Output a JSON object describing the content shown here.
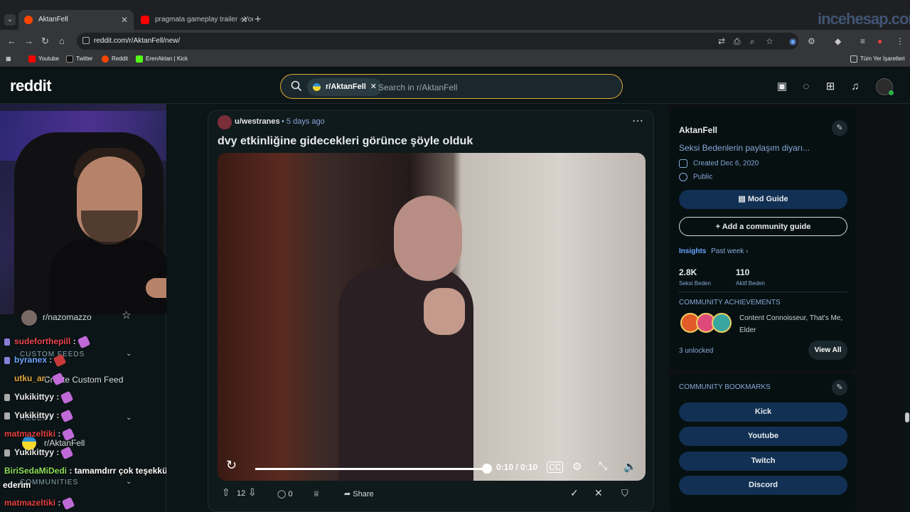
{
  "browser": {
    "tabs": [
      {
        "label": "AktanFell",
        "active": true
      },
      {
        "label": "pragmata gameplay trailer - YouTu",
        "active": false
      }
    ],
    "url": "reddit.com/r/AktanFell/new/",
    "watermark": "incehesap.com",
    "bookmarks": [
      "Youtube",
      "Twitter",
      "Reddit",
      "ErenAktan | Kick"
    ],
    "bookmarks_right": "Tüm Yer İşaretleri"
  },
  "header": {
    "logo": "reddit",
    "search_chip": "r/AktanFell",
    "search_placeholder": "Search in r/AktanFell"
  },
  "sidebar": {
    "recent_community": "r/nazomazzo",
    "custom_feeds_label": "CUSTOM FEEDS",
    "create_custom_feed": "Create Custom Feed",
    "recent_label": "RECENT",
    "recent_item": "r/AktanFell",
    "communities_label": "COMMUNITIES"
  },
  "chat": [
    {
      "user": "sudeforthepill",
      "text": ":",
      "color": "#e8474e"
    },
    {
      "user": "byranex",
      "text": ":",
      "color": "#6aa6ff"
    },
    {
      "user": "utku_ar",
      "text": ":",
      "color": "#e0a838"
    },
    {
      "user": "Yukikittyy",
      "text": ":",
      "color": "#e8e8e8"
    },
    {
      "user": "Yukikittyy",
      "text": ":",
      "color": "#e8e8e8"
    },
    {
      "user": "matmazeltiki",
      "text": ":",
      "color": "#e84040"
    },
    {
      "user": "Yukikittyy",
      "text": ":",
      "color": "#e8e8e8"
    },
    {
      "user": "BiriSedaMiDedi",
      "text": ": tamamdırr çok teşekkür",
      "color": "#8ee05a"
    },
    {
      "user": "",
      "text": "ederim",
      "color": "#ffffff"
    },
    {
      "user": "matmazeltiki",
      "text": ":",
      "color": "#e84040"
    }
  ],
  "post": {
    "author": "u/westranes",
    "time": "• 5 days ago",
    "title": "dvy etkinliğine gidecekleri görünce şöyle olduk",
    "video_time": "0:10 / 0:10",
    "video_progress": 1.0,
    "votes": "12",
    "comments": "0",
    "share": "Share"
  },
  "community": {
    "name": "AktanFell",
    "description": "Seksi Bedenlerin paylaşım diyarı...",
    "created": "Created Dec 6, 2020",
    "visibility": "Public",
    "mod_guide": "Mod Guide",
    "add_guide": "Add a community guide",
    "insights": "Insights",
    "insights_period": "Past week",
    "members_value": "2.8K",
    "members_label": "Seksi Beden",
    "online_value": "110",
    "online_label": "Aktif Beden",
    "achievements_title": "COMMUNITY ACHIEVEMENTS",
    "achievements_text": "Content Connoisseur, That's Me, Elder",
    "unlocked": "3 unlocked",
    "view_all": "View All",
    "bookmarks_title": "COMMUNITY BOOKMARKS",
    "bookmarks": [
      "Kick",
      "Youtube",
      "Twitch",
      "Discord"
    ]
  },
  "colors": {
    "accent": "#e0a838",
    "link": "#88a8d8",
    "button": "#113053"
  }
}
